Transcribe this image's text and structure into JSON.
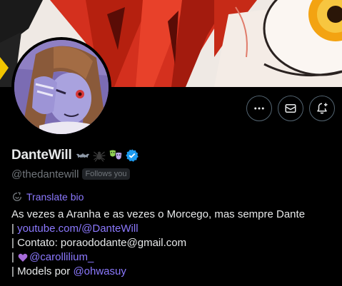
{
  "profile": {
    "display_name": "DanteWill",
    "name_emojis": [
      "bat-emoji",
      "spider-emoji",
      "theater-masks-emoji",
      "verified-badge"
    ],
    "handle": "@thedantewill",
    "follows_badge": "Follows you",
    "translate_label": "Translate bio"
  },
  "actions": {
    "more_icon": "more-horizontal-icon",
    "message_icon": "envelope-icon",
    "subscribe_icon": "bell-plus-icon"
  },
  "bio": {
    "line1": "As vezes a Aranha e as vezes o Morcego, mas sempre Dante",
    "line2_prefix": "| ",
    "line2_link": "youtube.com/@DanteWill",
    "line3": "| Contato: poraododante@gmail.com",
    "line4_prefix": "| ",
    "line4_link": "@carollilium_",
    "line5_prefix": "| Models por ",
    "line5_link": "@ohwasuy"
  },
  "colors": {
    "accent": "#8c79ff",
    "verified": "#1d9bf0",
    "muted": "#71767b",
    "background": "#000000",
    "text": "#e7e9ea"
  }
}
